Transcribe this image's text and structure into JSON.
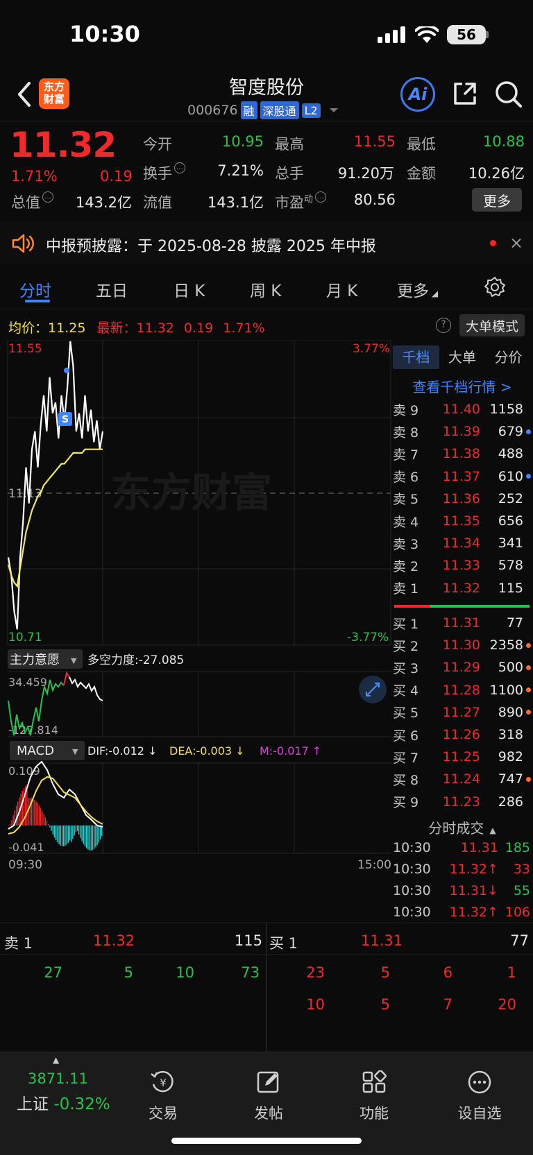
{
  "status": {
    "time": "10:30",
    "battery": "56"
  },
  "header": {
    "logo_text": "东方\n财富",
    "logo_line1": "东方",
    "logo_line2": "财富",
    "name": "智度股份",
    "code": "000676",
    "tags": [
      "融",
      "深股通",
      "L2"
    ],
    "ai_label": "Ai"
  },
  "quote": {
    "price": "11.32",
    "pct": "1.71%",
    "change": "0.19",
    "open_label": "今开",
    "open": "10.95",
    "high_label": "最高",
    "high": "11.55",
    "low_label": "最低",
    "low": "10.88",
    "turnover_label": "换手",
    "turnover": "7.21%",
    "volume_label": "总手",
    "volume": "91.20万",
    "amount_label": "金额",
    "amount": "10.26亿",
    "total_cap_label": "总值",
    "total_cap": "143.2亿",
    "float_cap_label": "流值",
    "float_cap": "143.1亿",
    "pe_label": "市盈",
    "pe_sup": "动",
    "pe": "80.56",
    "more_label": "更多"
  },
  "notice": {
    "text": "中报预披露：于 2025-08-28 披露 2025 年中报",
    "close": "×"
  },
  "tabs": [
    "分时",
    "五日",
    "日 K",
    "周 K",
    "月 K",
    "更多"
  ],
  "avg_line": {
    "avg_label": "均价：",
    "avg": "11.25",
    "latest_label": "最新：",
    "latest": "11.32",
    "chg": "0.19",
    "pct": "1.71%",
    "big_order_btn": "大单模式"
  },
  "chart_labels": {
    "top_price": "11.55",
    "top_pct": "3.77%",
    "mid_price": "11.13",
    "bottom_price": "10.71",
    "bottom_pct": "-3.77%",
    "watermark": "东方财富",
    "zlyy_label": "主力意愿",
    "dkld_label": "多空力度:-27.085",
    "zlyy_top": "34.459",
    "zlyy_bottom": "-127.814",
    "macd_label": "MACD",
    "dif": "DIF:-0.012 ↓",
    "dea": "DEA:-0.003 ↓",
    "m": "M:-0.017 ↑",
    "macd_top": "0.109",
    "macd_bottom": "-0.041",
    "time_start": "09:30",
    "time_end": "15:00"
  },
  "chart_data": {
    "type": "line",
    "series": [
      {
        "name": "价格",
        "values": [
          10.95,
          10.9,
          10.8,
          10.75,
          10.95,
          11.05,
          11.2,
          11.1,
          11.25,
          11.3,
          11.2,
          11.32,
          11.4,
          11.3,
          11.45,
          11.35,
          11.38,
          11.28,
          11.4,
          11.33,
          11.42,
          11.55,
          11.48,
          11.3,
          11.35,
          11.28,
          11.4,
          11.3,
          11.36,
          11.27,
          11.33,
          11.25,
          11.3
        ]
      },
      {
        "name": "均价",
        "values": [
          10.93,
          10.9,
          10.88,
          10.87,
          10.92,
          10.97,
          11.02,
          11.05,
          11.08,
          11.1,
          11.12,
          11.13,
          11.15,
          11.16,
          11.17,
          11.18,
          11.19,
          11.2,
          11.21,
          11.21,
          11.22,
          11.23,
          11.24,
          11.24,
          11.24,
          11.24,
          11.25,
          11.25,
          11.25,
          11.25,
          11.25,
          11.25,
          11.25
        ]
      }
    ],
    "ylim": [
      10.71,
      11.55
    ]
  },
  "order_book": {
    "tabs": [
      "千档",
      "大单",
      "分价"
    ],
    "link": "查看千档行情 >",
    "sells": [
      {
        "label": "卖 9",
        "price": "11.40",
        "vol": "1158",
        "dot": ""
      },
      {
        "label": "卖 8",
        "price": "11.39",
        "vol": "679",
        "dot": "#3d86ff"
      },
      {
        "label": "卖 7",
        "price": "11.38",
        "vol": "488",
        "dot": ""
      },
      {
        "label": "卖 6",
        "price": "11.37",
        "vol": "610",
        "dot": "#3d86ff"
      },
      {
        "label": "卖 5",
        "price": "11.36",
        "vol": "252",
        "dot": ""
      },
      {
        "label": "卖 4",
        "price": "11.35",
        "vol": "656",
        "dot": ""
      },
      {
        "label": "卖 3",
        "price": "11.34",
        "vol": "341",
        "dot": ""
      },
      {
        "label": "卖 2",
        "price": "11.33",
        "vol": "578",
        "dot": ""
      },
      {
        "label": "卖 1",
        "price": "11.32",
        "vol": "115",
        "dot": ""
      }
    ],
    "buys": [
      {
        "label": "买 1",
        "price": "11.31",
        "vol": "77",
        "dot": ""
      },
      {
        "label": "买 2",
        "price": "11.30",
        "vol": "2358",
        "dot": "#ff6a2a"
      },
      {
        "label": "买 3",
        "price": "11.29",
        "vol": "500",
        "dot": "#ff6a2a"
      },
      {
        "label": "买 4",
        "price": "11.28",
        "vol": "1100",
        "dot": "#ff6a2a"
      },
      {
        "label": "买 5",
        "price": "11.27",
        "vol": "890",
        "dot": "#ff6a2a"
      },
      {
        "label": "买 6",
        "price": "11.26",
        "vol": "318",
        "dot": ""
      },
      {
        "label": "买 7",
        "price": "11.25",
        "vol": "982",
        "dot": ""
      },
      {
        "label": "买 8",
        "price": "11.24",
        "vol": "747",
        "dot": "#ff6a2a"
      },
      {
        "label": "买 9",
        "price": "11.23",
        "vol": "286",
        "dot": ""
      }
    ],
    "trades_title": "分时成交",
    "trades": [
      {
        "time": "10:30",
        "price": "11.31",
        "vol": "185",
        "price_color": "red",
        "vol_color": "green"
      },
      {
        "time": "10:30",
        "price": "11.32↑",
        "vol": "33",
        "price_color": "red",
        "vol_color": "red"
      },
      {
        "time": "10:30",
        "price": "11.31↓",
        "vol": "55",
        "price_color": "red",
        "vol_color": "green"
      },
      {
        "time": "10:30",
        "price": "11.32↑",
        "vol": "106",
        "price_color": "red",
        "vol_color": "red"
      }
    ]
  },
  "queue": {
    "sell1_label": "卖 1",
    "sell1_price": "11.32",
    "sell1_vol": "115",
    "buy1_label": "买 1",
    "buy1_price": "11.31",
    "buy1_vol": "77",
    "sell_orders": [
      "27",
      "5",
      "10",
      "73"
    ],
    "buy_orders_row1": [
      "23",
      "5",
      "6",
      "1"
    ],
    "buy_orders_row2": [
      "10",
      "5",
      "7",
      "20"
    ]
  },
  "bottom_nav": {
    "index_value": "3871.11",
    "index_name": "上证",
    "index_pct": "-0.32%",
    "items": [
      "交易",
      "发帖",
      "功能",
      "设自选"
    ]
  }
}
